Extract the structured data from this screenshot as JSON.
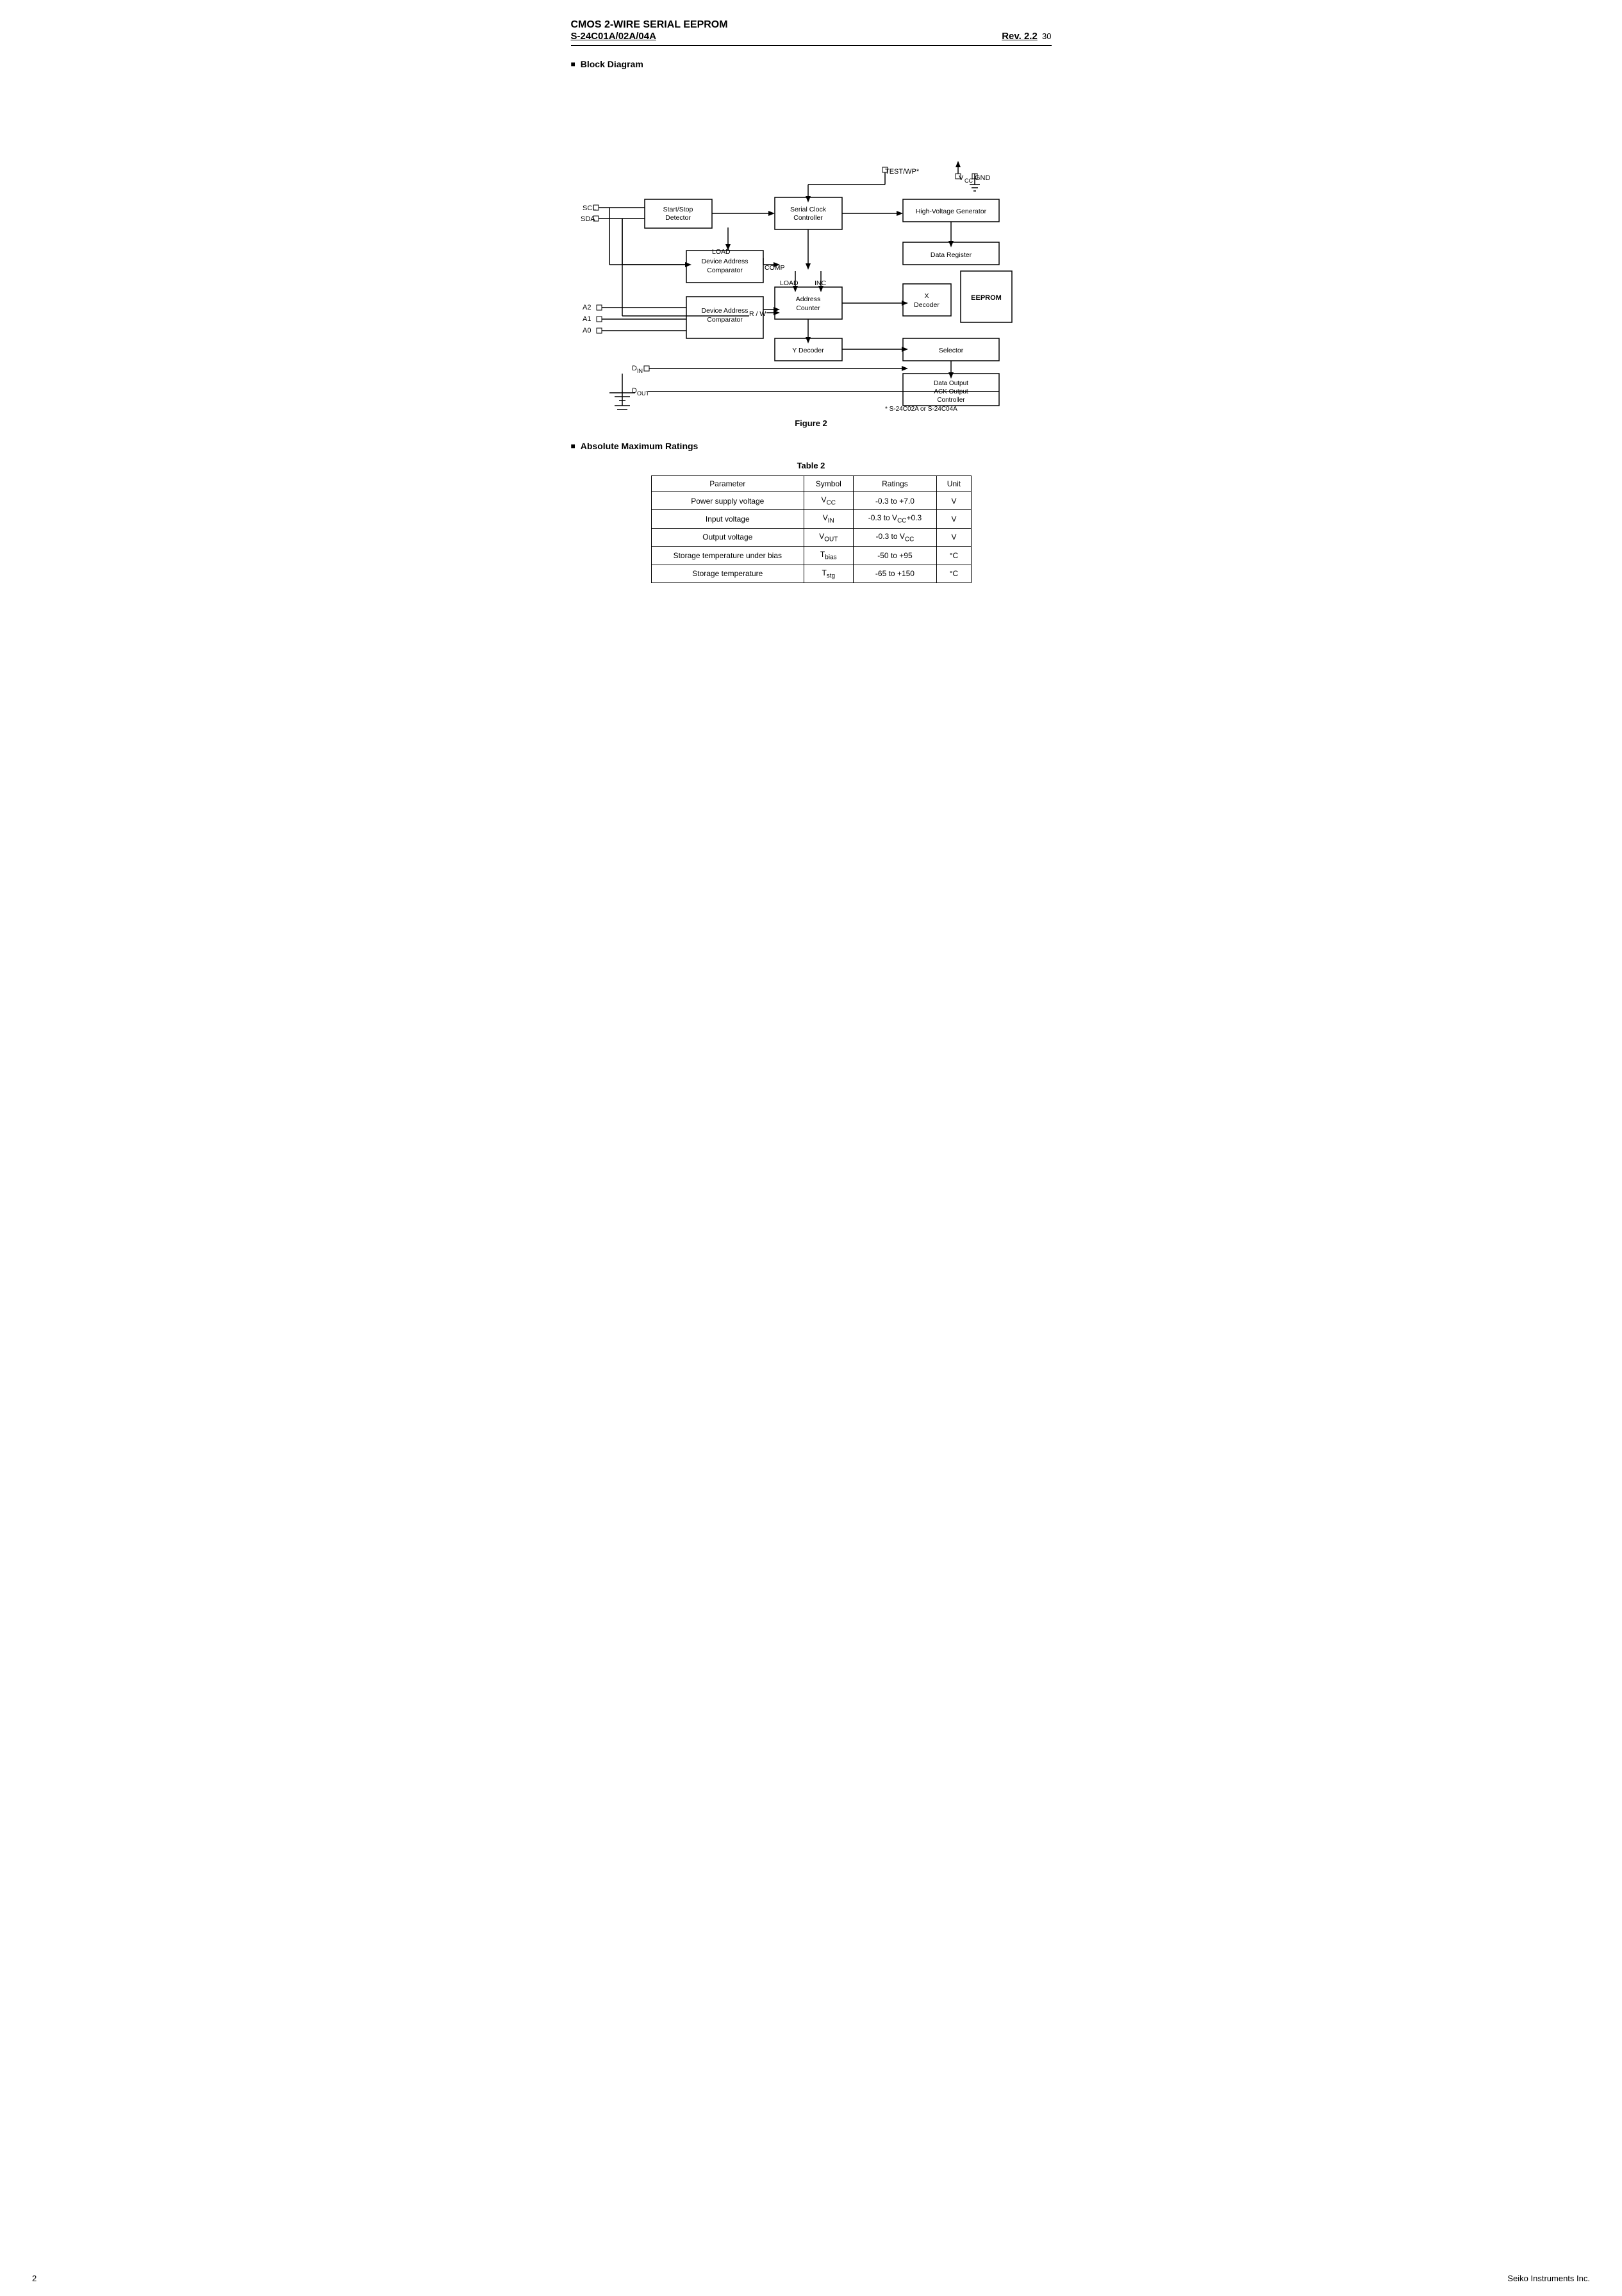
{
  "header": {
    "title": "CMOS 2-WIRE SERIAL  EEPROM",
    "subtitle": "S-24C01A/02A/04A",
    "rev": "Rev. 2.2",
    "page_suffix": "30"
  },
  "block_diagram": {
    "section_label": "Block Diagram",
    "figure_label": "Figure 2",
    "footnote": "* S-24C02A or S-24C04A",
    "blocks": {
      "start_stop": "Start/Stop\nDetector",
      "serial_clock": "Serial Clock\nController",
      "high_voltage": "High-Voltage Generator",
      "device_address": "Device Address\nComparator",
      "address_counter": "Address\nCounter",
      "data_register": "Data Register",
      "x_decoder": "X\nDecoder",
      "eeprom": "EEPROM",
      "y_decoder": "Y Decoder",
      "selector": "Selector",
      "data_output": "Data Output\nACK Output\nController"
    },
    "labels": {
      "scl": "SCL",
      "sda": "SDA",
      "a2": "A2",
      "a1": "A1",
      "a0": "A0",
      "din": "D",
      "din_sub": "IN",
      "dout": "D",
      "dout_sub": "OUT",
      "vcc": "V",
      "vcc_sub": "CC",
      "gnd": "GND",
      "test_wp": "TEST/WP*",
      "load": "LOAD",
      "comp": "COMP",
      "load2": "LOAD",
      "inc": "INC",
      "rw": "R / W"
    }
  },
  "table": {
    "caption": "Table  2",
    "headers": [
      "Parameter",
      "Symbol",
      "Ratings",
      "Unit"
    ],
    "rows": [
      [
        "Power supply voltage",
        "V_CC",
        "-0.3 to +7.0",
        "V"
      ],
      [
        "Input voltage",
        "V_IN",
        "-0.3 to V_CC+0.3",
        "V"
      ],
      [
        "Output voltage",
        "V_OUT",
        "-0.3 to V_CC",
        "V"
      ],
      [
        "Storage temperature under bias",
        "T_bias",
        "-50 to +95",
        "°C"
      ],
      [
        "Storage temperature",
        "T_stg",
        "-65 to +150",
        "°C"
      ]
    ]
  },
  "absolute_ratings": {
    "section_label": "Absolute Maximum Ratings"
  },
  "footer": {
    "page_number": "2",
    "company": "Seiko Instruments Inc."
  }
}
